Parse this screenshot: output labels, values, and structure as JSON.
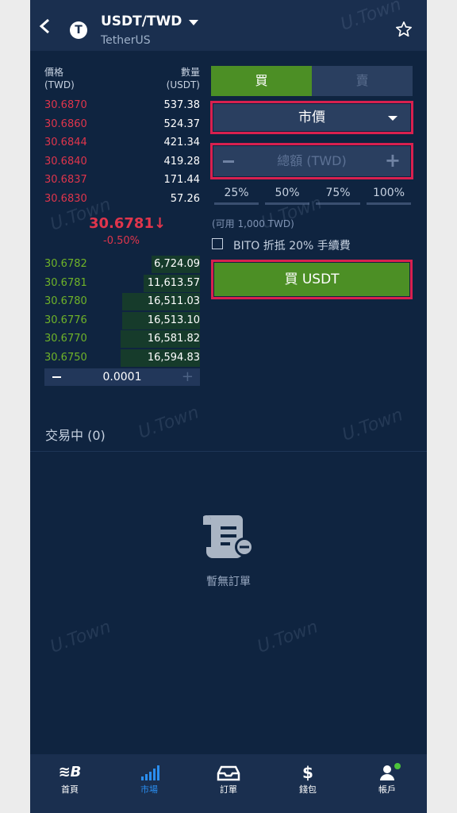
{
  "header": {
    "pair": "USDT/TWD",
    "subtitle": "TetherUS",
    "coin_letter": "T"
  },
  "orderbook": {
    "price_header": "價格",
    "price_unit": "(TWD)",
    "qty_header": "數量",
    "qty_unit": "(USDT)",
    "asks": [
      {
        "price": "30.6870",
        "qty": "537.38"
      },
      {
        "price": "30.6860",
        "qty": "524.37"
      },
      {
        "price": "30.6844",
        "qty": "421.34"
      },
      {
        "price": "30.6840",
        "qty": "419.28"
      },
      {
        "price": "30.6837",
        "qty": "171.44"
      },
      {
        "price": "30.6830",
        "qty": "57.26"
      }
    ],
    "last_price": "30.6781",
    "last_arrow": "↓",
    "change": "-0.50%",
    "bids": [
      {
        "price": "30.6782",
        "qty": "6,724.09",
        "depth": 0.31
      },
      {
        "price": "30.6781",
        "qty": "11,613.57",
        "depth": 0.36
      },
      {
        "price": "30.6780",
        "qty": "16,511.03",
        "depth": 0.5
      },
      {
        "price": "30.6776",
        "qty": "16,513.10",
        "depth": 0.5
      },
      {
        "price": "30.6770",
        "qty": "16,581.82",
        "depth": 0.51
      },
      {
        "price": "30.6750",
        "qty": "16,594.83",
        "depth": 0.51
      }
    ],
    "step": "0.0001"
  },
  "form": {
    "buy_tab": "買",
    "sell_tab": "賣",
    "order_type": "市價",
    "amount_placeholder": "總額 (TWD)",
    "percents": [
      "25%",
      "50%",
      "75%",
      "100%"
    ],
    "available": "(可用 1,000 TWD)",
    "fee_checkbox": "BITO 折抵 20% 手續費",
    "submit": "買 USDT"
  },
  "orders": {
    "title": "交易中 (0)",
    "empty": "暫無訂單"
  },
  "watermark": "U.Town",
  "nav": [
    {
      "label": "首頁",
      "icon": "home-logo-icon"
    },
    {
      "label": "市場",
      "icon": "market-bars-icon"
    },
    {
      "label": "訂單",
      "icon": "orders-tray-icon"
    },
    {
      "label": "錢包",
      "icon": "wallet-dollar-icon"
    },
    {
      "label": "帳戶",
      "icon": "account-user-icon"
    }
  ],
  "colors": {
    "ask": "#e0354c",
    "bid": "#6fb328",
    "accent": "#4c8f25",
    "highlight": "#d8204f",
    "nav_active": "#2a8ef0"
  }
}
